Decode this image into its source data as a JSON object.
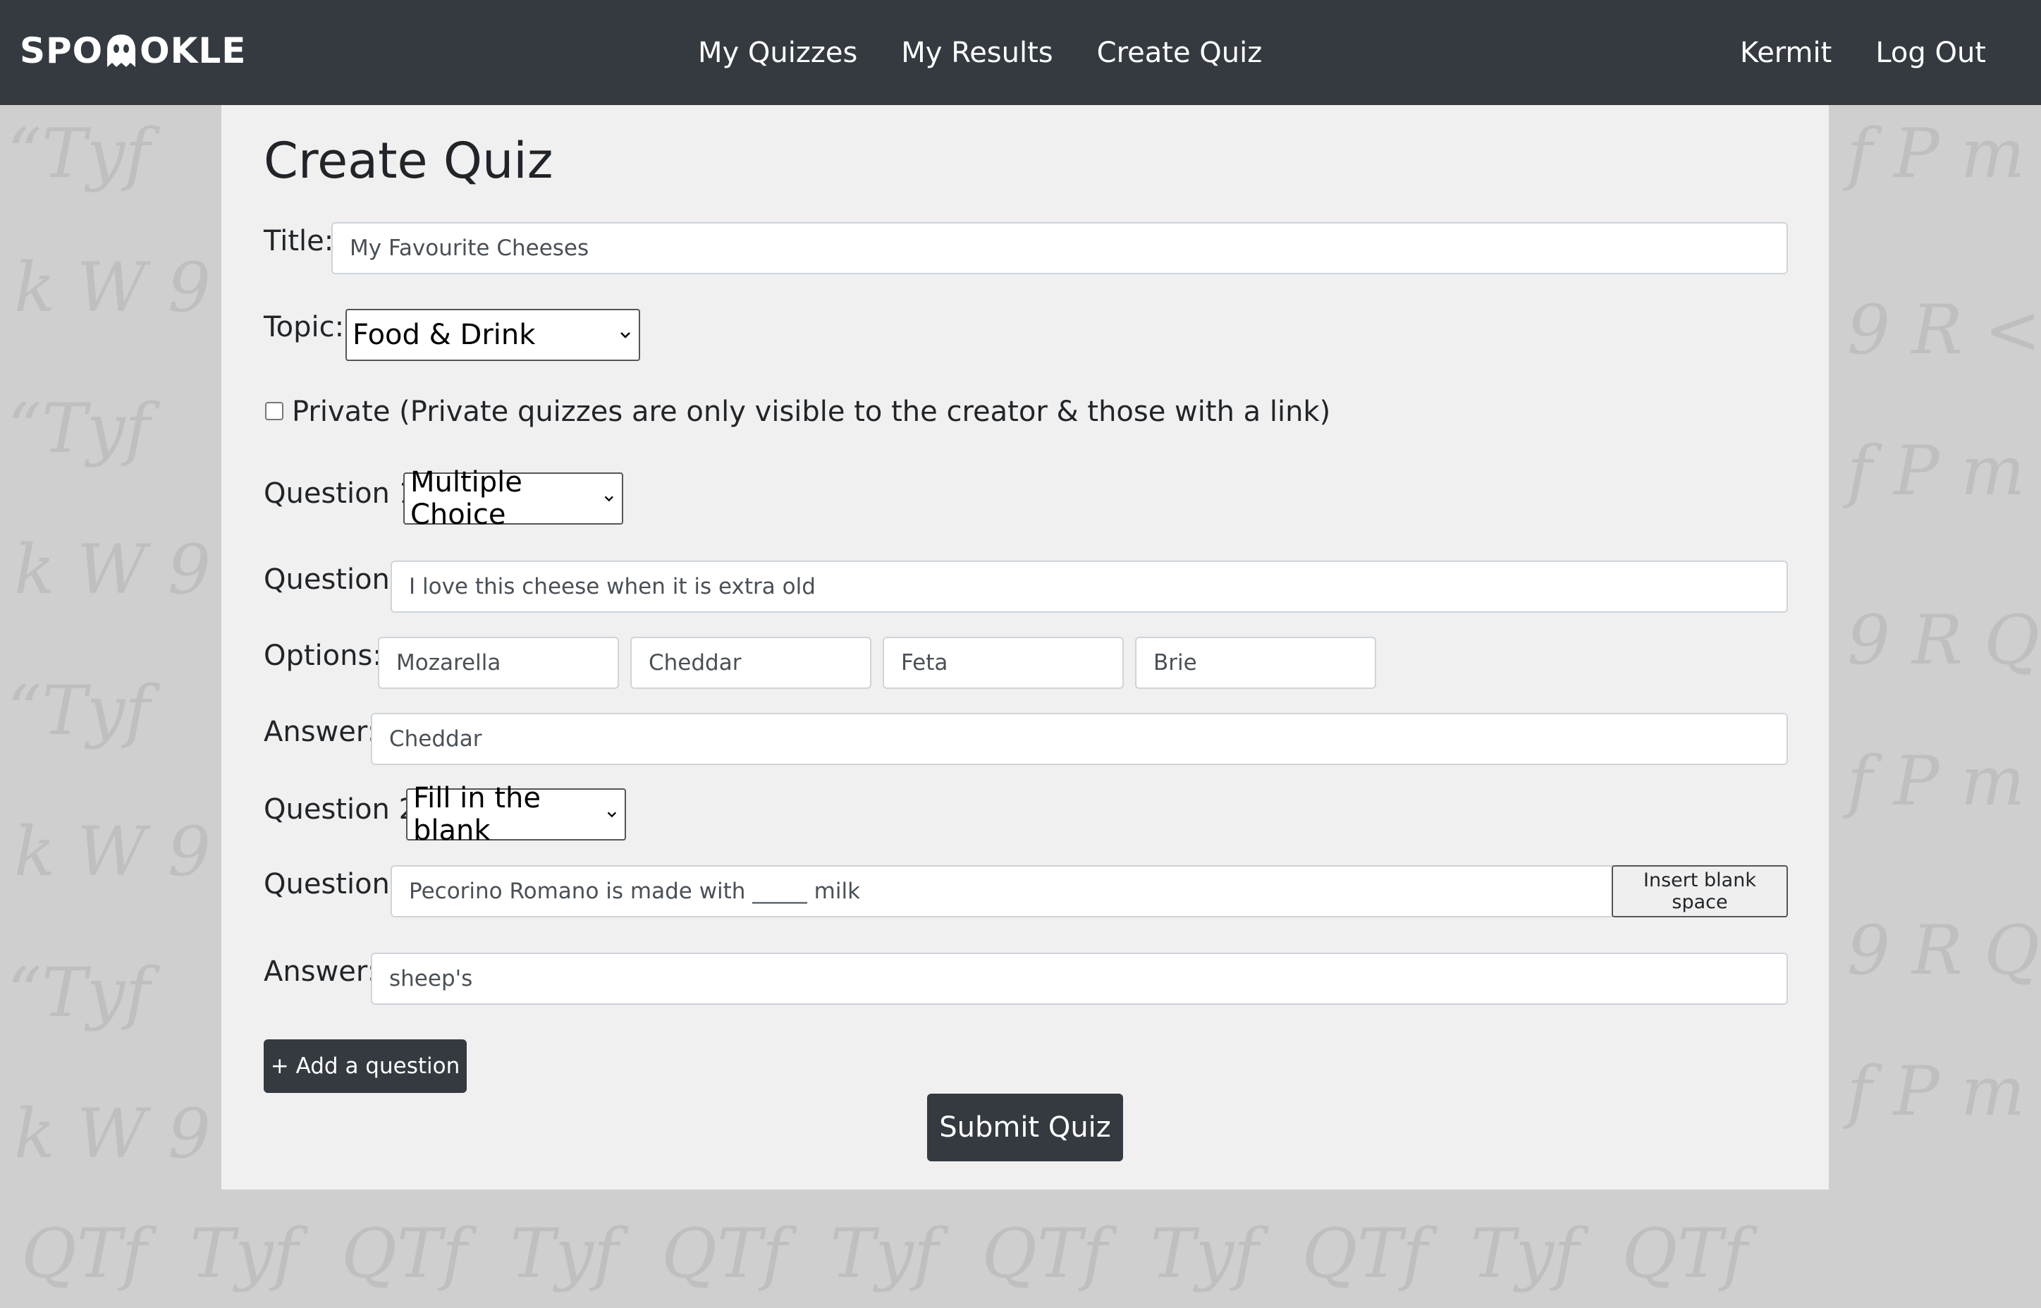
{
  "app": {
    "logo_text_left": "SPO",
    "logo_text_right": "OKLE"
  },
  "nav": {
    "center": [
      "My Quizzes",
      "My Results",
      "Create Quiz"
    ],
    "user": "Kermit",
    "logout": "Log Out"
  },
  "form": {
    "page_title": "Create Quiz",
    "title_label": "Title:",
    "title_value": "My Favourite Cheeses",
    "topic_label": "Topic:",
    "topic_value": "Food & Drink",
    "private_label": "Private (Private quizzes are only visible to the creator & those with a link)",
    "private_checked": false,
    "questions": [
      {
        "heading": "Question 1",
        "type": "Multiple Choice",
        "question_label": "Question:",
        "question_value": "I love this cheese when it is extra old",
        "options_label": "Options:",
        "options": [
          "Mozarella",
          "Cheddar",
          "Feta",
          "Brie"
        ],
        "answer_label": "Answer:",
        "answer_value": "Cheddar"
      },
      {
        "heading": "Question 2",
        "type": "Fill in the blank",
        "question_label": "Question:",
        "question_value": "Pecorino Romano is made with _____ milk",
        "insert_blank_label": "Insert blank space",
        "answer_label": "Answer:",
        "answer_value": "sheep's"
      }
    ],
    "add_question_label": "+ Add a question",
    "submit_label": "Submit Quiz"
  },
  "colors": {
    "navbar": "#343a40",
    "card": "#f0f0f0",
    "background": "#cfcfcf",
    "button_dark": "#343a40"
  }
}
